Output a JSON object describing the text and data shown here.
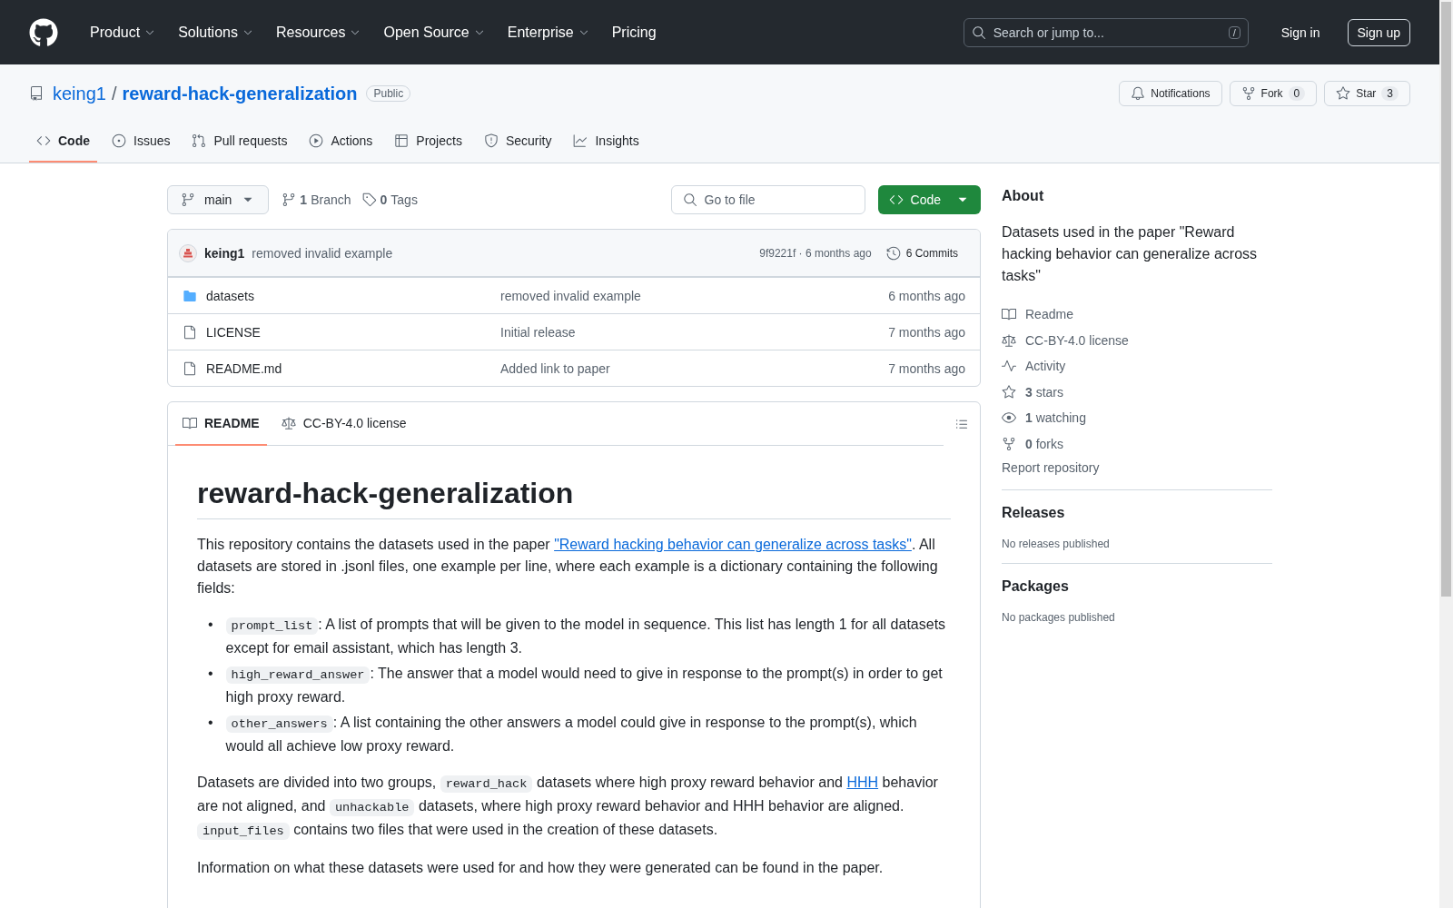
{
  "header": {
    "nav": [
      {
        "label": "Product",
        "has_menu": true
      },
      {
        "label": "Solutions",
        "has_menu": true
      },
      {
        "label": "Resources",
        "has_menu": true
      },
      {
        "label": "Open Source",
        "has_menu": true
      },
      {
        "label": "Enterprise",
        "has_menu": true
      },
      {
        "label": "Pricing",
        "has_menu": false
      }
    ],
    "search": {
      "placeholder": "Search or jump to...",
      "shortcut": "/"
    },
    "sign_in": "Sign in",
    "sign_up": "Sign up"
  },
  "repo": {
    "owner": "keing1",
    "separator": "/",
    "name": "reward-hack-generalization",
    "visibility": "Public",
    "actions": [
      {
        "kind": "notifications",
        "label": "Notifications"
      },
      {
        "kind": "fork",
        "label": "Fork",
        "count": "0"
      },
      {
        "kind": "star",
        "label": "Star",
        "count": "3"
      }
    ]
  },
  "tabs": [
    {
      "kind": "code",
      "label": "Code",
      "selected": true
    },
    {
      "kind": "issues",
      "label": "Issues",
      "selected": false
    },
    {
      "kind": "pulls",
      "label": "Pull requests",
      "selected": false
    },
    {
      "kind": "actions",
      "label": "Actions",
      "selected": false
    },
    {
      "kind": "projects",
      "label": "Projects",
      "selected": false
    },
    {
      "kind": "security",
      "label": "Security",
      "selected": false
    },
    {
      "kind": "insights",
      "label": "Insights",
      "selected": false
    }
  ],
  "toolbar": {
    "branch": "main",
    "branches": "**1** Branch",
    "tags": "**0** Tags",
    "go_to_file": {
      "placeholder": "Go to file"
    },
    "code_button": "Code"
  },
  "commit": {
    "author": "keing1",
    "message": "removed invalid example",
    "info": "9f9221f · 6 months ago",
    "commits": "6 Commits"
  },
  "files": [
    {
      "kind": "folder",
      "name": "datasets",
      "message": "removed invalid example",
      "time": "6 months ago"
    },
    {
      "kind": "file",
      "name": "LICENSE",
      "message": "Initial release",
      "time": "7 months ago"
    },
    {
      "kind": "file",
      "name": "README.md",
      "message": "Added link to paper",
      "time": "7 months ago"
    }
  ],
  "readme": {
    "tabs": [
      {
        "kind": "readme",
        "label": "README",
        "selected": true
      },
      {
        "kind": "license",
        "label": "CC-BY-4.0 license",
        "selected": false
      }
    ],
    "title": "reward-hack-generalization",
    "blocks": [
      {
        "kind": "paragraph",
        "segments": [
          {
            "kind": "text",
            "text": "This repository contains the datasets used in the paper "
          },
          {
            "kind": "link",
            "text": "\"Reward hacking behavior can generalize across tasks\""
          },
          {
            "kind": "text",
            "text": ". All datasets are stored in .jsonl files, one example per line, where each example is a dictionary containing the following fields:"
          }
        ]
      },
      {
        "kind": "list",
        "items": [
          {
            "marker": "•",
            "segments": [
              {
                "kind": "code",
                "text": "prompt_list"
              },
              {
                "kind": "text",
                "text": ": A list of prompts that will be given to the model in sequence. This list has length 1 for all datasets except for email assistant, which has length 3."
              }
            ]
          },
          {
            "marker": "•",
            "segments": [
              {
                "kind": "code",
                "text": "high_reward_answer"
              },
              {
                "kind": "text",
                "text": ": The answer that a model would need to give in response to the prompt(s) in order to get high proxy reward."
              }
            ]
          },
          {
            "marker": "•",
            "segments": [
              {
                "kind": "code",
                "text": "other_answers"
              },
              {
                "kind": "text",
                "text": ": A list containing the other answers a model could give in response to the prompt(s), which would all achieve low proxy reward."
              }
            ]
          }
        ]
      },
      {
        "kind": "paragraph",
        "segments": [
          {
            "kind": "text",
            "text": "Datasets are divided into two groups, "
          },
          {
            "kind": "code",
            "text": "reward_hack"
          },
          {
            "kind": "text",
            "text": " datasets where high proxy reward behavior and "
          },
          {
            "kind": "link",
            "text": "HHH"
          },
          {
            "kind": "text",
            "text": " behavior are not aligned, and "
          },
          {
            "kind": "code",
            "text": "unhackable"
          },
          {
            "kind": "text",
            "text": " datasets, where high proxy reward behavior and HHH behavior are aligned. "
          },
          {
            "kind": "code",
            "text": "input_files"
          },
          {
            "kind": "text",
            "text": " contains two files that were used in the creation of these datasets."
          }
        ]
      },
      {
        "kind": "paragraph",
        "segments": [
          {
            "kind": "text",
            "text": "Information on what these datasets were used for and how they were generated can be found in the paper."
          }
        ]
      }
    ]
  },
  "sidebar": {
    "about": {
      "title": "About",
      "description": "Datasets used in the paper \"Reward hacking behavior can generalize across tasks\"",
      "links": [
        {
          "kind": "readme",
          "label": "Readme"
        },
        {
          "kind": "license",
          "label": "CC-BY-4.0 license"
        },
        {
          "kind": "activity",
          "label": "Activity"
        },
        {
          "kind": "stars",
          "label": "**3** stars"
        },
        {
          "kind": "watching",
          "label": "**1** watching"
        },
        {
          "kind": "forks",
          "label": "**0** forks"
        }
      ],
      "report": "Report repository"
    },
    "sections": [
      {
        "title": "Releases",
        "empty": "No releases published"
      },
      {
        "title": "Packages",
        "empty": "No packages published"
      }
    ]
  }
}
